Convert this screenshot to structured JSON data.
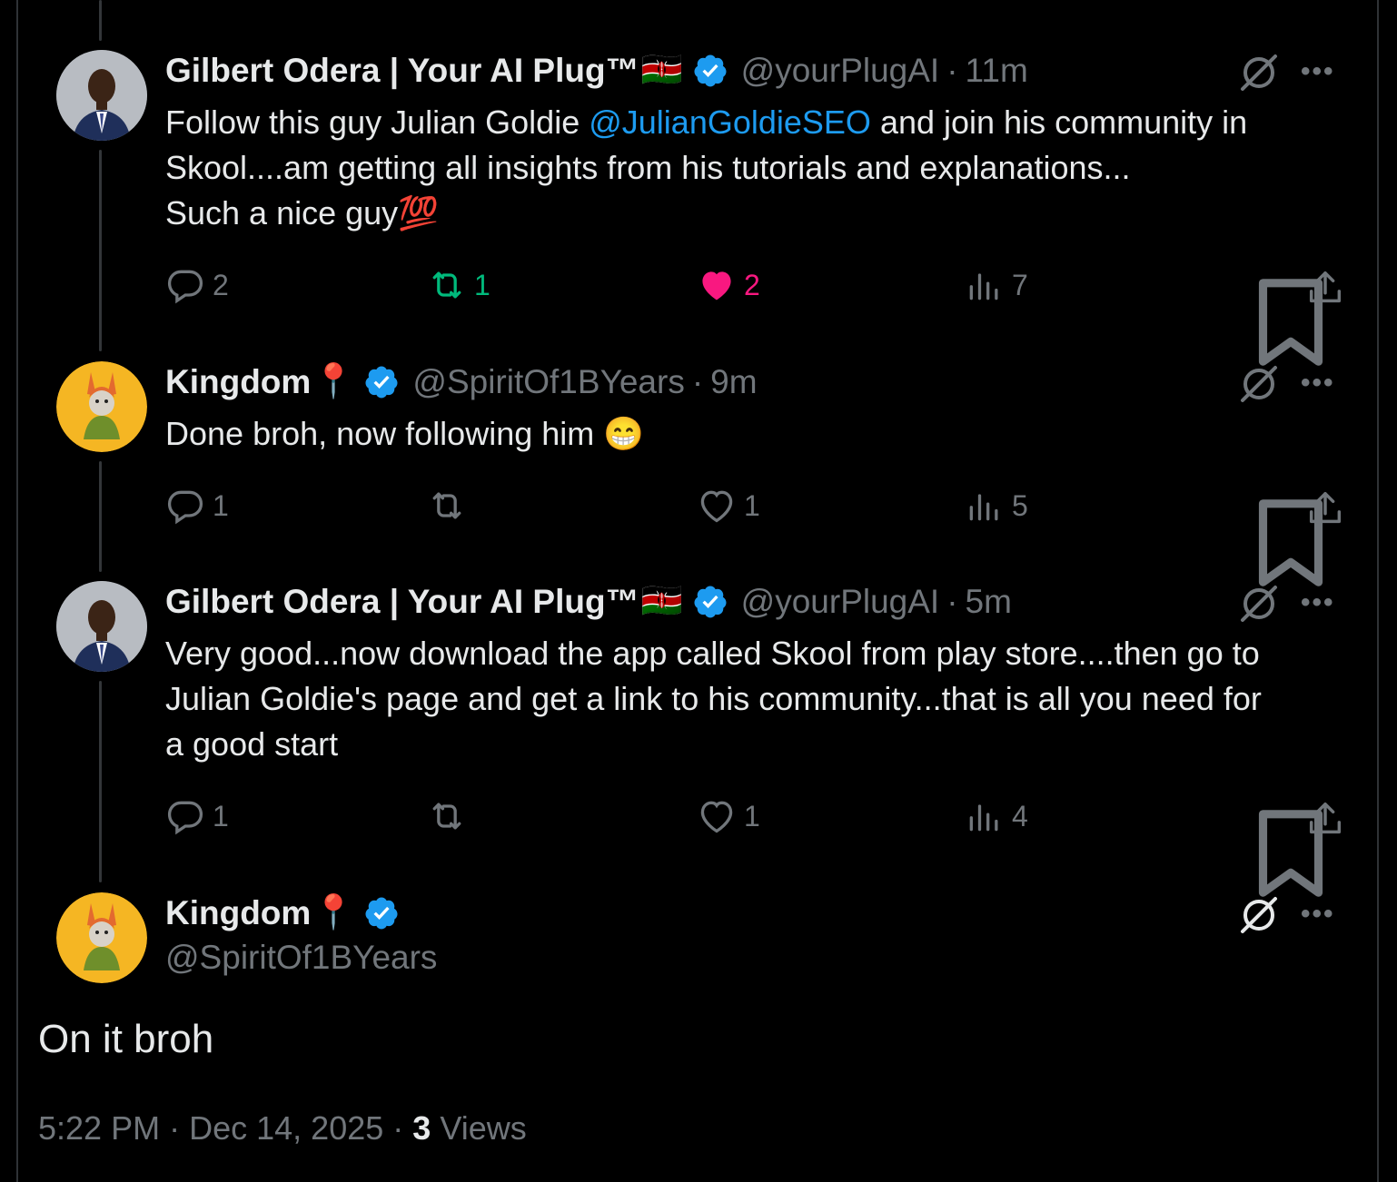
{
  "tweets": [
    {
      "name": "Gilbert Odera | Your AI Plug™",
      "name_emoji": "🇰🇪",
      "handle": "@yourPlugAI",
      "sep": "·",
      "time": "11m",
      "text_before": "Follow this guy Julian Goldie ",
      "mention": "@JulianGoldieSEO",
      "text_after": " and join his community in\nSkool....am getting all insights from his tutorials and explanations...\nSuch a nice guy💯",
      "replies": "2",
      "reposts": "1",
      "likes": "2",
      "views": "7",
      "avatar": "man-in-suit",
      "repost_active": true,
      "like_active": true
    },
    {
      "name": "Kingdom",
      "name_emoji": "📍",
      "handle": "@SpiritOf1BYears",
      "sep": "·",
      "time": "9m",
      "text": "Done broh, now following him 😁",
      "replies": "1",
      "reposts": "",
      "likes": "1",
      "views": "5",
      "avatar": "cartoon-rabbit"
    },
    {
      "name": "Gilbert Odera | Your AI Plug™",
      "name_emoji": "🇰🇪",
      "handle": "@yourPlugAI",
      "sep": "·",
      "time": "5m",
      "text": "Very good...now download the app called Skool from play store....then go to\nJulian Goldie's page and get a link to his community...that is all you need for\na good start",
      "replies": "1",
      "reposts": "",
      "likes": "1",
      "views": "4",
      "avatar": "man-in-suit"
    }
  ],
  "main_tweet": {
    "name": "Kingdom",
    "name_emoji": "📍",
    "handle": "@SpiritOf1BYears",
    "text": "On it broh",
    "time": "5:22 PM",
    "date": "Dec 14, 2025",
    "sep": "·",
    "views_count": "3",
    "views_label": "Views"
  },
  "colors": {
    "background": "#000000",
    "text": "#e7e9ea",
    "muted": "#71767b",
    "link": "#1d9bf0",
    "repost_active": "#00ba7c",
    "like_active": "#f91880",
    "verified": "#1d9bf0"
  }
}
